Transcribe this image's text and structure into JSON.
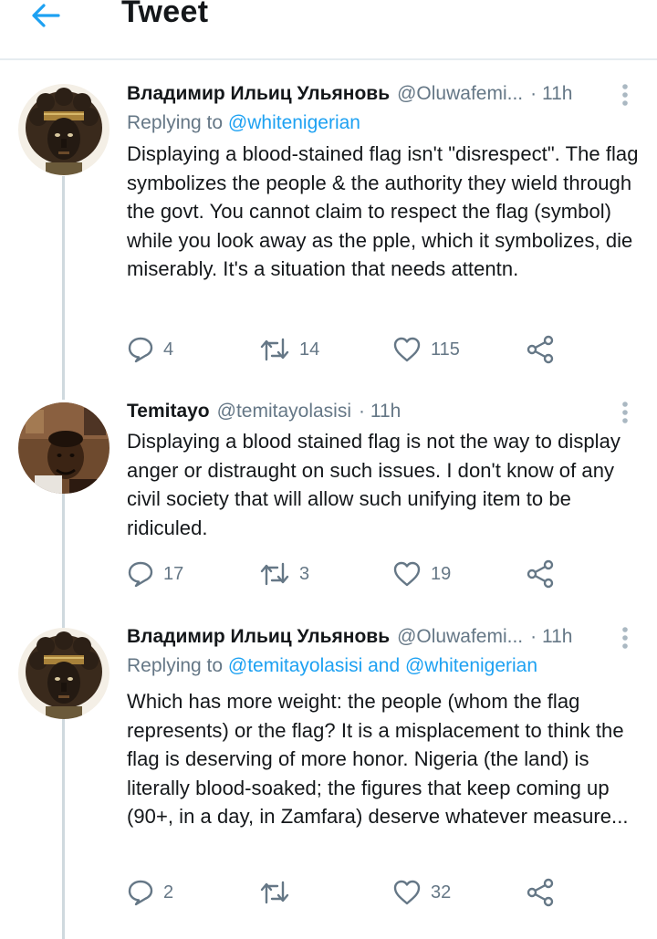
{
  "header": {
    "title": "Tweet"
  },
  "tweets": [
    {
      "name": "Владимир Ильиц Ульяновь",
      "handle": "@Oluwafemi...",
      "time": "· 11h",
      "reply_prefix": "Replying to ",
      "reply_mentions": "@whitenigerian",
      "text": "Displaying a blood-stained flag isn't \"disrespect\". The flag symbolizes the people & the authority they wield through the govt. You cannot claim to respect the flag (symbol) while you look away as the pple, which it symbolizes, die miserably. It's a situation that needs attentn.",
      "replies": "4",
      "retweets": "14",
      "likes": "115"
    },
    {
      "name": "Temitayo",
      "handle": "@temitayolasisi",
      "time": "· 11h",
      "text": "Displaying a blood stained flag is not the way to display anger or distraught on such issues. I don't know of any civil society that will allow such unifying item to be ridiculed.",
      "replies": "17",
      "retweets": "3",
      "likes": "19"
    },
    {
      "name": "Владимир Ильиц Ульяновь",
      "handle": "@Oluwafemi...",
      "time": "· 11h",
      "reply_prefix": "Replying to ",
      "reply_mentions": "@temitayolasisi and @whitenigerian",
      "text": "Which has more weight: the people (whom the flag represents) or the flag? It is a misplacement to think the flag is deserving of more honor. Nigeria (the land) is literally blood-soaked; the figures that keep coming up (90+, in a day, in Zamfara) deserve whatever measure...",
      "replies": "2",
      "retweets": "",
      "likes": "32"
    }
  ],
  "colors": {
    "accent": "#1da1f2",
    "muted": "#657786",
    "text": "#14171a",
    "divider": "#e6ecf0"
  }
}
